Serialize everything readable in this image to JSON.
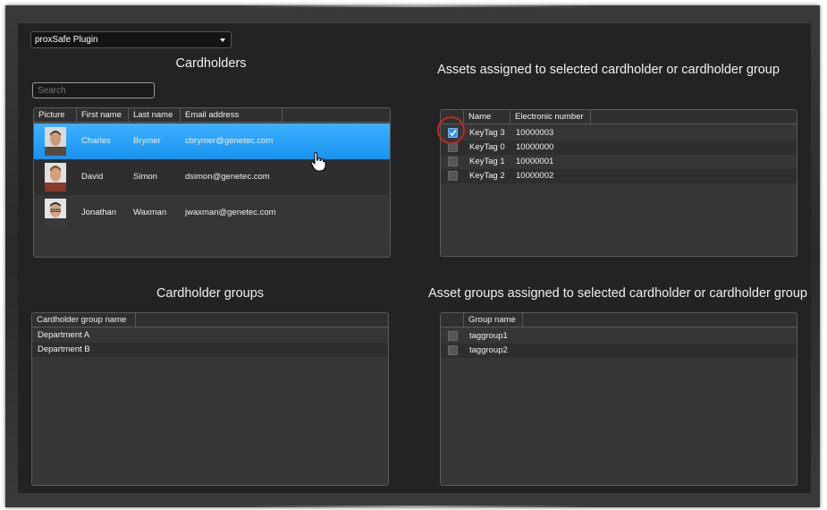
{
  "plugin_dropdown": {
    "value": "proxSafe Plugin"
  },
  "cardholders": {
    "title": "Cardholders",
    "search_placeholder": "Search",
    "columns": [
      "Picture",
      "First name",
      "Last name",
      "Email address"
    ],
    "rows": [
      {
        "first": "Charles",
        "last": "Brymer",
        "email": "cbrymer@genetec.com",
        "selected": true
      },
      {
        "first": "David",
        "last": "Simon",
        "email": "dsimon@genetec.com",
        "selected": false
      },
      {
        "first": "Jonathan",
        "last": "Waxman",
        "email": "jwaxman@genetec.com",
        "selected": false
      }
    ]
  },
  "assets": {
    "title": "Assets assigned to selected cardholder or cardholder group",
    "columns": [
      "Name",
      "Electronic number"
    ],
    "rows": [
      {
        "name": "KeyTag 3",
        "number": "10000003",
        "checked": true
      },
      {
        "name": "KeyTag 0",
        "number": "10000000",
        "checked": false
      },
      {
        "name": "KeyTag 1",
        "number": "10000001",
        "checked": false
      },
      {
        "name": "KeyTag 2",
        "number": "10000002",
        "checked": false
      }
    ]
  },
  "cardholder_groups": {
    "title": "Cardholder groups",
    "columns": [
      "Cardholder group name"
    ],
    "rows": [
      "Department A",
      "Department B"
    ]
  },
  "asset_groups": {
    "title": "Asset groups assigned to selected cardholder or cardholder group",
    "columns": [
      "Group name"
    ],
    "rows": [
      {
        "name": "taggroup1",
        "checked": false
      },
      {
        "name": "taggroup2",
        "checked": false
      }
    ]
  },
  "colors": {
    "selection": "#1e9af0",
    "accent_ring": "#c0282a",
    "search_text": "#3aa0ff"
  }
}
